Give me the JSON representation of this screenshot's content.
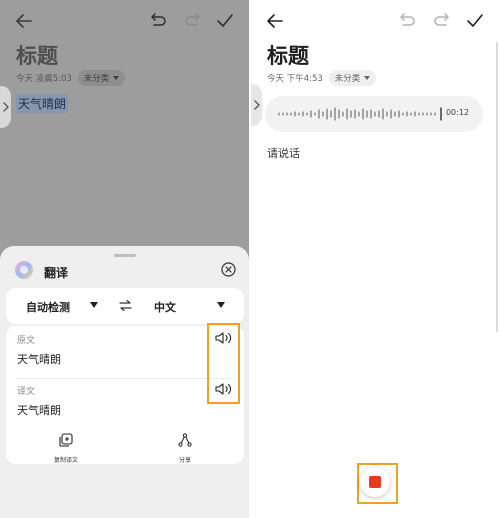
{
  "left": {
    "note": {
      "title": "标题",
      "timestamp": "今天 凌晨5:03",
      "category": "未分类",
      "selected_text": "天气晴朗"
    },
    "translate_sheet": {
      "title": "翻译",
      "source_lang": "自动检测",
      "target_lang": "中文",
      "original_label": "原文",
      "original_text": "天气晴朗",
      "translation_label": "译文",
      "translation_text": "天气晴朗",
      "copy_label": "复制译文",
      "share_label": "分享"
    }
  },
  "right": {
    "note": {
      "title": "标题",
      "timestamp": "今天 下午4:53",
      "category": "未分类"
    },
    "recording": {
      "duration": "00:12",
      "prompt": "请说话"
    }
  },
  "icons": [
    "back-arrow-icon",
    "undo-icon",
    "redo-icon",
    "checkmark-icon",
    "chevron-right-icon",
    "translate-logo-icon",
    "close-icon",
    "swap-icon",
    "speaker-icon",
    "copy-translation-icon",
    "share-icon",
    "stop-icon"
  ],
  "colors": {
    "highlight_box": "#f0a025",
    "stop_button": "#e63b1e",
    "selection": "#8796ac"
  }
}
